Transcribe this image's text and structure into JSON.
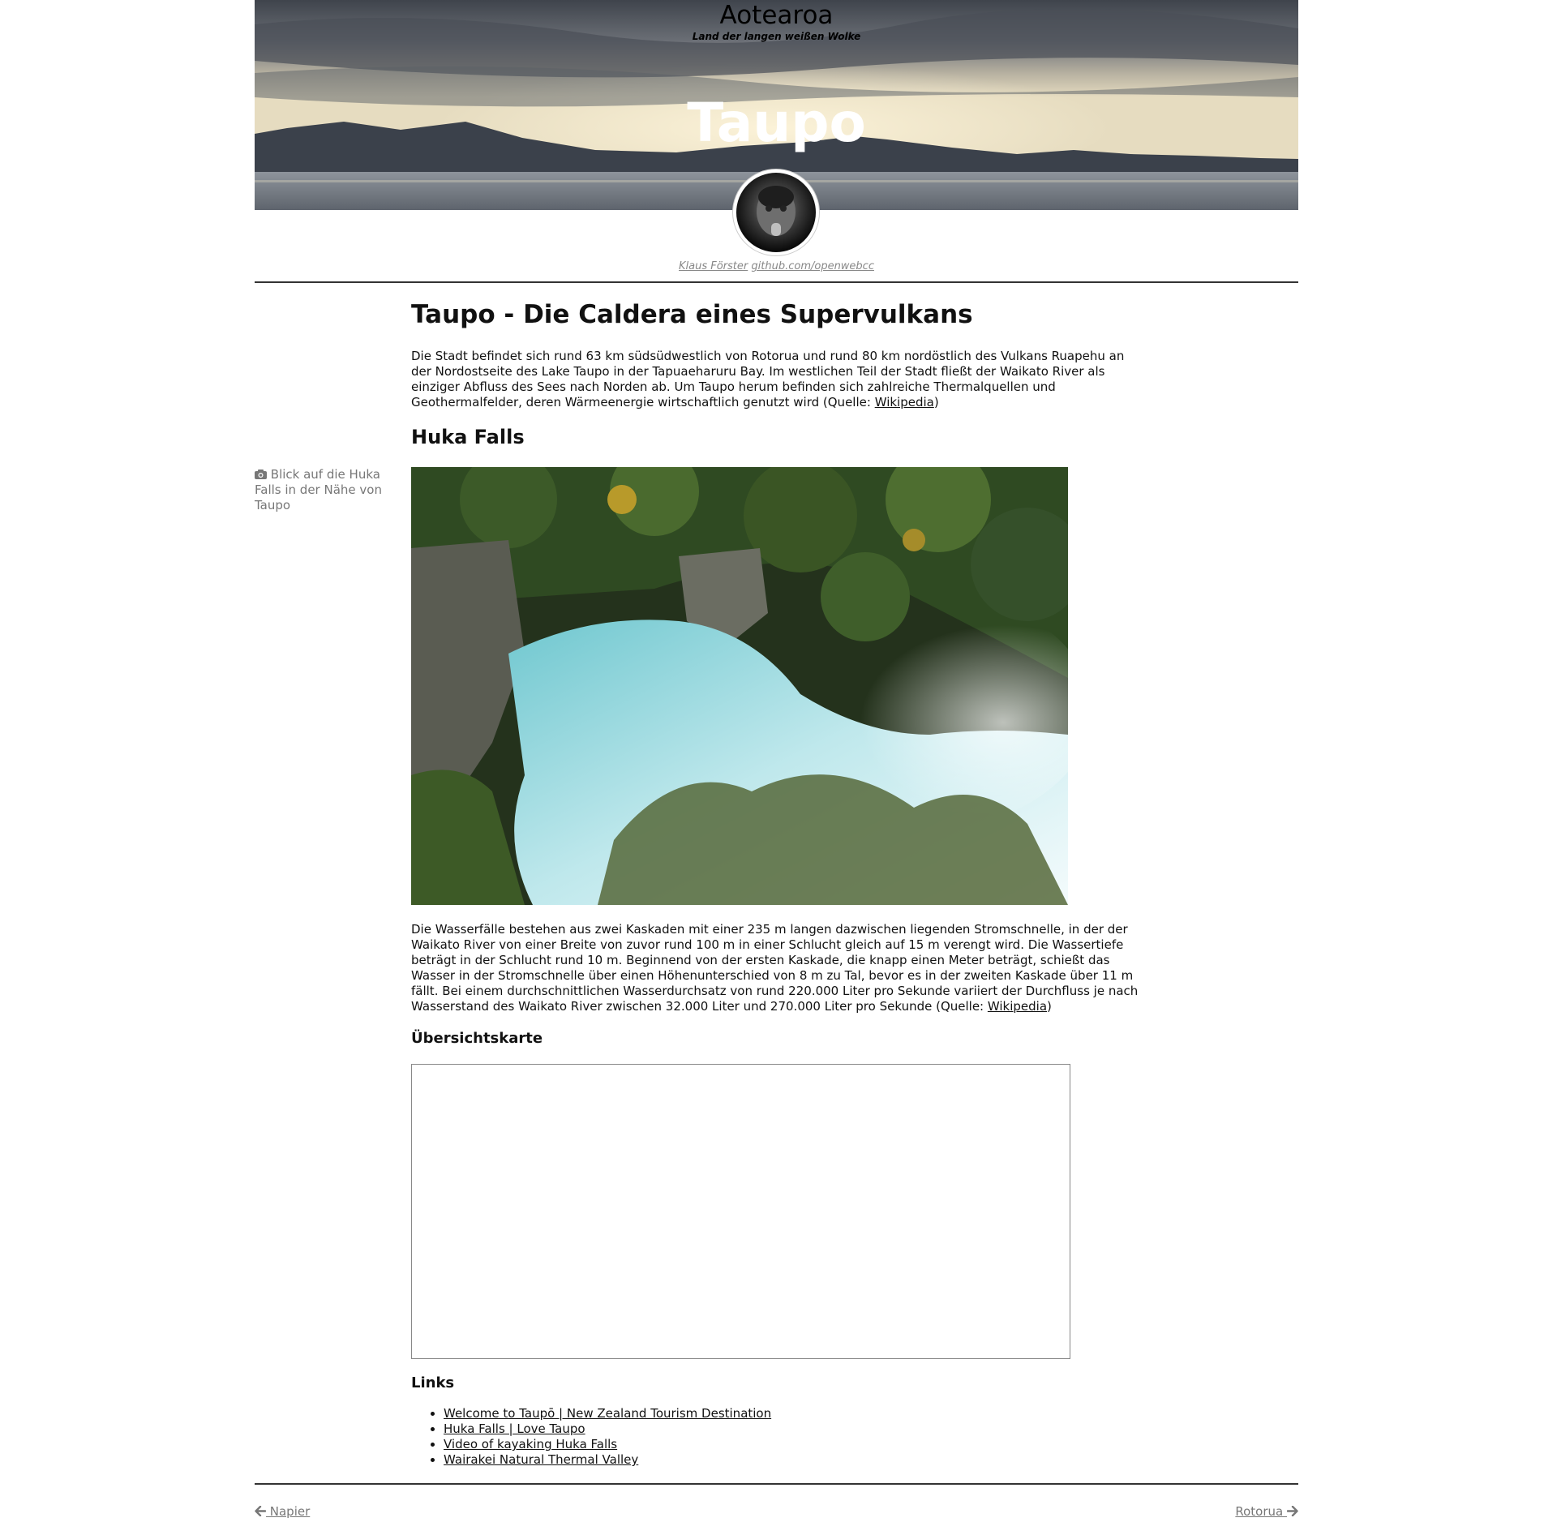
{
  "header": {
    "site_title": "Aotearoa",
    "site_subtitle": "Land der langen weißen Wolke",
    "banner_heading": "Taupo",
    "author_name": "Klaus Förster",
    "author_link": "github.com/openwebcc"
  },
  "article": {
    "title": "Taupo - Die Caldera eines Supervulkans",
    "intro_text": "Die Stadt befindet sich rund 63 km südsüdwestlich von Rotorua und rund 80 km nordöstlich des Vulkans Ruapehu an der Nordostseite des Lake Taupo in der Tapuaeharuru Bay. Im westlichen Teil der Stadt fließt der Waikato River als einziger Abfluss des Sees nach Norden ab. Um Taupo herum befinden sich zahlreiche Thermalquellen und Geothermalfelder, deren Wärmeenergie wirtschaftlich genutzt wird (Quelle: ",
    "intro_link": "Wikipedia",
    "intro_close": ")",
    "section_huka": "Huka Falls",
    "photo_caption": "Blick auf die Huka Falls in der Nähe von Taupo",
    "huka_text": "Die Wasserfälle bestehen aus zwei Kaskaden mit einer 235 m langen dazwischen liegenden Stromschnelle, in der der Waikato River von einer Breite von zuvor rund 100 m in einer Schlucht gleich auf 15 m verengt wird. Die Wassertiefe beträgt in der Schlucht rund 10 m. Beginnend von der ersten Kaskade, die knapp einen Meter beträgt, schießt das Wasser in der Stromschnelle über einen Höhenunterschied von 8 m zu Tal, bevor es in der zweiten Kaskade über 11 m fällt. Bei einem durchschnittlichen Wasserdurchsatz von rund 220.000 Liter pro Sekunde variiert der Durchfluss je nach Wasserstand des Waikato River zwischen 32.000 Liter und 270.000 Liter pro Sekunde (Quelle: ",
    "huka_link": "Wikipedia",
    "huka_close": ")",
    "map_heading": "Übersichtskarte",
    "links_heading": "Links",
    "links": [
      "Welcome to Taupō | New Zealand Tourism Destination",
      "Huka Falls | Love Taupo",
      "Video of kayaking Huka Falls",
      "Wairakei Natural Thermal Valley"
    ]
  },
  "footer_nav": {
    "prev_label": " Napier",
    "next_label": "Rotorua "
  },
  "icons": {
    "caption_icon": "camera-icon",
    "prev_icon": "arrow-left-icon",
    "next_icon": "arrow-right-icon"
  }
}
